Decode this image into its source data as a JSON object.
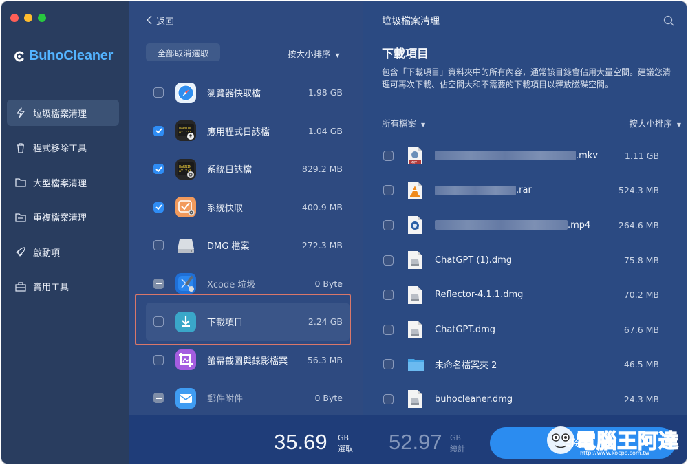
{
  "app": {
    "name": "BuhoCleaner",
    "colors": {
      "accent": "#2f8df5",
      "logo": "#53b3ff",
      "sidebar": "#293d5f",
      "panel": "#2e4a80",
      "bar": "#1f3d79"
    }
  },
  "sidebar": {
    "items": [
      {
        "label": "垃圾檔案清理",
        "icon": "bolt-icon",
        "active": true
      },
      {
        "label": "程式移除工具",
        "icon": "trash-icon",
        "active": false
      },
      {
        "label": "大型檔案清理",
        "icon": "folder-icon",
        "active": false
      },
      {
        "label": "重複檔案清理",
        "icon": "duplicate-folder-icon",
        "active": false
      },
      {
        "label": "啟動項",
        "icon": "rocket-icon",
        "active": false
      },
      {
        "label": "實用工具",
        "icon": "toolbox-icon",
        "active": false
      }
    ]
  },
  "middle": {
    "back_label": "返回",
    "deselect_label": "全部取消選取",
    "sort_label": "按大小排序",
    "categories": [
      {
        "name": "瀏覽器快取檔",
        "size": "1.98 GB",
        "state": "unchecked",
        "icon": "safari-icon"
      },
      {
        "name": "應用程式日誌檔",
        "size": "1.04 GB",
        "state": "checked",
        "icon": "app-log-icon"
      },
      {
        "name": "系統日誌檔",
        "size": "829.2 MB",
        "state": "checked",
        "icon": "system-log-icon"
      },
      {
        "name": "系統快取",
        "size": "400.9 MB",
        "state": "checked",
        "icon": "system-cache-icon"
      },
      {
        "name": "DMG 檔案",
        "size": "272.3 MB",
        "state": "unchecked",
        "icon": "disk-image-icon"
      },
      {
        "name": "Xcode 垃圾",
        "size": "0 Byte",
        "state": "partial",
        "icon": "xcode-icon"
      },
      {
        "name": "下載項目",
        "size": "2.24 GB",
        "state": "unchecked",
        "icon": "download-icon"
      },
      {
        "name": "螢幕截圖與錄影檔案",
        "size": "56.3 MB",
        "state": "unchecked",
        "icon": "screenshot-icon"
      },
      {
        "name": "郵件附件",
        "size": "0 Byte",
        "state": "partial",
        "icon": "mail-icon"
      }
    ]
  },
  "right": {
    "title": "垃圾檔案清理",
    "heading": "下載項目",
    "description": "包含「下載項目」資料夾中的所有內容，通常該目錄會佔用大量空間。建議您清理可再次下載、佔空間大和不需要的下載項目以釋放磁碟空間。",
    "filter_label": "所有檔案",
    "sort_label": "按大小排序",
    "files": [
      {
        "name": ".mkv",
        "size": "1.11 GB",
        "icon": "mkv-file-icon",
        "blurred": true
      },
      {
        "name": ".rar",
        "size": "524.3 MB",
        "icon": "vlc-file-icon",
        "blurred": true
      },
      {
        "name": ".mp4",
        "size": "264.6 MB",
        "icon": "quicktime-file-icon",
        "blurred": true
      },
      {
        "name": "ChatGPT (1).dmg",
        "size": "75.8 MB",
        "icon": "dmg-file-icon",
        "blurred": false
      },
      {
        "name": "Reflector-4.1.1.dmg",
        "size": "70.2 MB",
        "icon": "dmg-file-icon",
        "blurred": false
      },
      {
        "name": "ChatGPT.dmg",
        "size": "67.6 MB",
        "icon": "dmg-file-icon",
        "blurred": false
      },
      {
        "name": "未命名檔案夾 2",
        "size": "46.5 MB",
        "icon": "folder-file-icon",
        "blurred": false
      },
      {
        "name": "buhocleaner.dmg",
        "size": "24.3 MB",
        "icon": "dmg-file-icon",
        "blurred": false
      }
    ]
  },
  "bottom": {
    "selected_value": "35.69",
    "selected_unit": "GB",
    "selected_label": "選取",
    "total_value": "52.97",
    "total_unit": "GB",
    "total_label": "總計",
    "clean_label": "清除"
  },
  "watermark": {
    "text": "電腦王阿達",
    "url": "http://www.kocpc.com.tw"
  }
}
